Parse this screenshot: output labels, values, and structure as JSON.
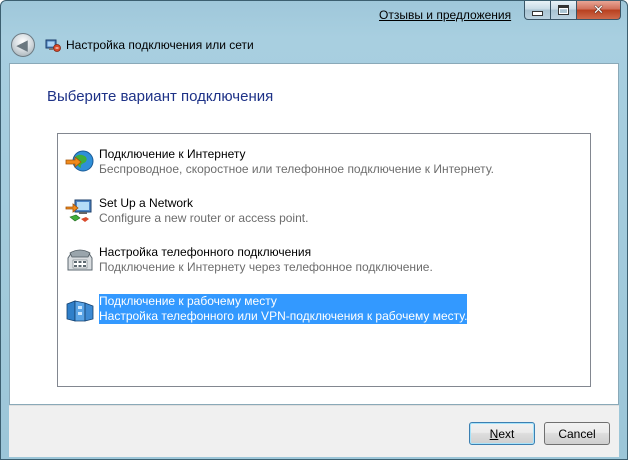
{
  "titlebar": {
    "feedback_link": "Отзывы и предложения",
    "close_symbol": "✕",
    "back_symbol": "◀"
  },
  "window": {
    "title": "Настройка подключения или сети"
  },
  "main": {
    "heading": "Выберите вариант подключения",
    "options": [
      {
        "title": "Подключение к Интернету",
        "description": "Беспроводное, скоростное или телефонное подключение к Интернету.",
        "icon": "internet-globe-icon",
        "selected": false
      },
      {
        "title": "Set Up a Network",
        "description": "Configure a new router or access point.",
        "icon": "network-router-icon",
        "selected": false
      },
      {
        "title": "Настройка телефонного подключения",
        "description": "Подключение к Интернету через телефонное подключение.",
        "icon": "dialup-phone-icon",
        "selected": false
      },
      {
        "title": "Подключение к рабочему месту",
        "description": "Настройка телефонного или VPN-подключения к рабочему месту.",
        "icon": "workplace-building-icon",
        "selected": true
      }
    ]
  },
  "footer": {
    "next_accel": "N",
    "next_rest": "ext",
    "cancel_label": "Cancel"
  },
  "colors": {
    "heading": "#1e3287",
    "selection": "#3399ff",
    "frame": "#9fc7da"
  }
}
